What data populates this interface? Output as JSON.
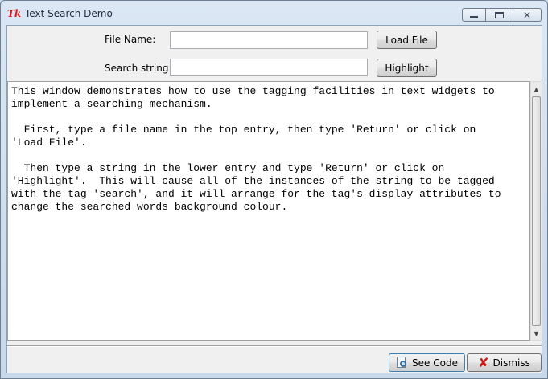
{
  "window": {
    "title": "Text Search Demo",
    "app_icon": "tk-feather-icon"
  },
  "form": {
    "file_label": "File Name:",
    "file_value": "",
    "load_button": "Load File",
    "search_label": "Search string:",
    "search_value": "",
    "highlight_button": "Highlight"
  },
  "text": {
    "content": "This window demonstrates how to use the tagging facilities in text widgets to\nimplement a searching mechanism.\n\n  First, type a file name in the top entry, then type 'Return' or click on\n'Load File'.\n\n  Then type a string in the lower entry and type 'Return' or click on\n'Highlight'.  This will cause all of the instances of the string to be tagged\nwith the tag 'search', and it will arrange for the tag's display attributes to\nchange the searched words background colour."
  },
  "footer": {
    "see_code_button": "See Code",
    "see_code_icon": "magnifier-document-icon",
    "dismiss_button": "Dismiss",
    "dismiss_icon": "red-x-icon"
  },
  "colors": {
    "titlebar": "#c8d9ec",
    "client_bg": "#f0f0f0",
    "dismiss_x": "#d01818"
  }
}
